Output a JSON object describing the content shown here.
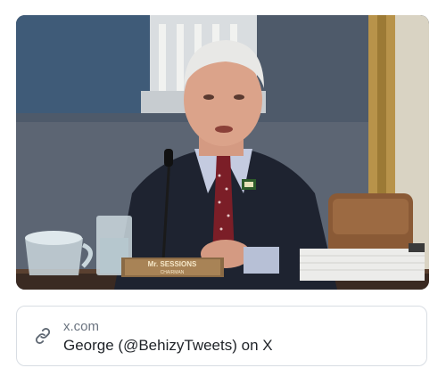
{
  "media": {
    "placard_line1": "Mr. SESSIONS",
    "placard_line2": "CHAIRMAN"
  },
  "link_card": {
    "icon": "link-icon",
    "domain": "x.com",
    "title": "George (@BehizyTweets) on X"
  }
}
